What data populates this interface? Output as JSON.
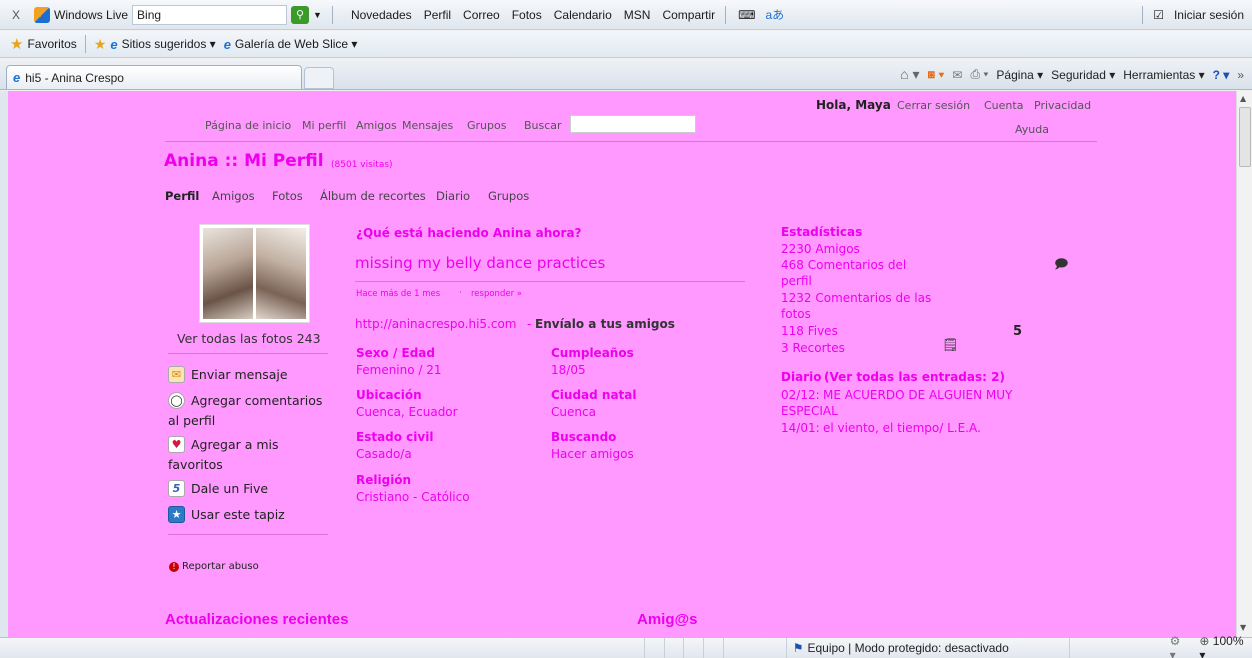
{
  "browser": {
    "toolbar": {
      "close": "X",
      "windows_live": "Windows Live",
      "bing_value": "Bing",
      "links": [
        "Novedades",
        "Perfil",
        "Correo",
        "Fotos",
        "Calendario",
        "MSN",
        "Compartir"
      ],
      "signin": "Iniciar sesión"
    },
    "favorites_bar": {
      "favorites": "Favoritos",
      "suggested": "Sitios sugeridos ▾",
      "web_slice": "Galería de Web Slice ▾"
    },
    "tab": {
      "title": "hi5 - Anina Crespo"
    },
    "command_bar": {
      "page": "Página ▾",
      "security": "Seguridad ▾",
      "tools": "Herramientas ▾"
    },
    "status": {
      "zone": "Equipo | Modo protegido: desactivado",
      "zoom": "100%"
    }
  },
  "hi5": {
    "top_nav": [
      "Página de inicio",
      "Mi perfil",
      "Amigos",
      "Mensajes",
      "Grupos"
    ],
    "search_label": "Buscar",
    "greeting": "Hola, Maya",
    "account_links": [
      "Cerrar sesión",
      "Cuenta",
      "Privacidad"
    ],
    "help": "Ayuda",
    "profile_title": "Anina :: Mi Perfil",
    "visits": "(8501 visitas)",
    "profile_tabs": [
      "Perfil",
      "Amigos",
      "Fotos",
      "Álbum de recortes",
      "Diario",
      "Grupos"
    ],
    "see_all_photos": "Ver todas las fotos 243",
    "actions": [
      {
        "label": "Enviar mensaje",
        "icon": "envelope-icon"
      },
      {
        "label": "Agregar comentarios",
        "label2": "al perfil",
        "icon": "comment-icon"
      },
      {
        "label": "Agregar a mis",
        "label2": "favoritos",
        "icon": "heart-icon"
      },
      {
        "label": "Dale un Five",
        "icon": "five-icon"
      },
      {
        "label": "Usar este tapiz",
        "icon": "star-icon"
      }
    ],
    "report": "Reportar abuso",
    "status_question": "¿Qué está haciendo Anina ahora?",
    "status_text": "missing my belly dance practices",
    "status_time": "Hace más de 1 mes",
    "status_reply": "responder »",
    "profile_url": "http://aninacrespo.hi5.com",
    "send_friends": "Envíalo a tus amigos",
    "fields": {
      "sexo_label": "Sexo / Edad",
      "sexo_value": "Femenino / 21",
      "cumple_label": "Cumpleaños",
      "cumple_value": "18/05",
      "ubicacion_label": "Ubicación",
      "ubicacion_value": "Cuenca, Ecuador",
      "natal_label": "Ciudad natal",
      "natal_value": "Cuenca",
      "civil_label": "Estado civil",
      "civil_value": "Casado/a",
      "buscando_label": "Buscando",
      "buscando_value": "Hacer amigos",
      "religion_label": "Religión",
      "religion_value": "Cristiano - Católico"
    },
    "stats": {
      "title": "Estadísticas",
      "friends": "2230 Amigos",
      "comments1": "468 Comentarios del",
      "comments1b": "perfil",
      "comments2": "1232 Comentarios de las",
      "comments2b": "fotos",
      "fives": "118 Fives",
      "five_count": "5",
      "clips": "3 Recortes"
    },
    "diary": {
      "title": "Diario",
      "see_all": "(Ver todas las entradas: 2)",
      "entry1_date": "02/12:",
      "entry1_text": "ME ACUERDO DE ALGUIEN MUY",
      "entry1_text2": "ESPECIAL",
      "entry2_date": "14/01:",
      "entry2_text": "el viento, el tiempo/ L.E.A."
    },
    "recent_updates": "Actualizaciones recientes",
    "friends_heading": "Amig@s"
  },
  "colors": {
    "page_bg": "#ff99ff",
    "accent": "#ee00ee"
  }
}
